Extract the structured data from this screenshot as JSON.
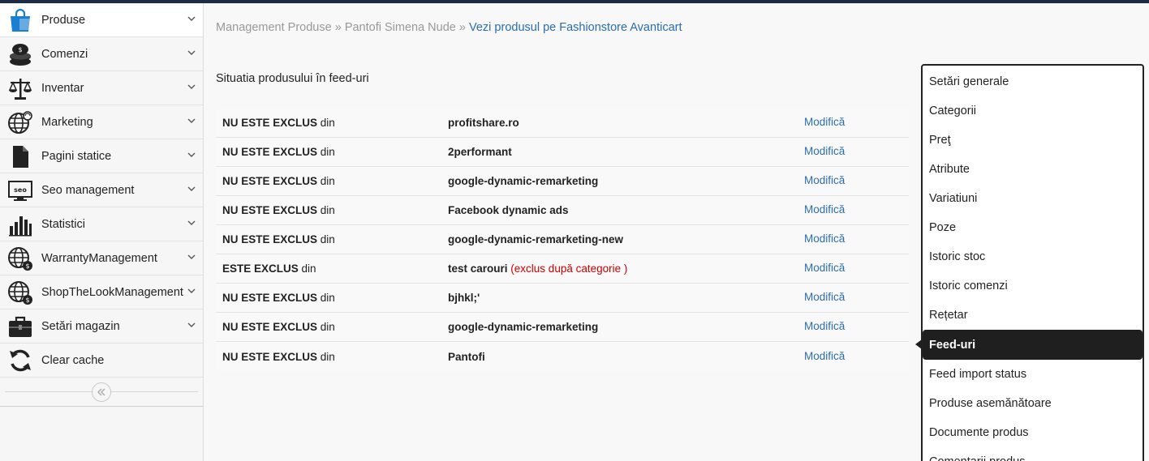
{
  "sidebar": {
    "items": [
      {
        "label": "Produse",
        "icon": "shopping-bag-icon",
        "active": true
      },
      {
        "label": "Comenzi",
        "icon": "coins-icon"
      },
      {
        "label": "Inventar",
        "icon": "scale-icon"
      },
      {
        "label": "Marketing",
        "icon": "globe-signal-icon"
      },
      {
        "label": "Pagini statice",
        "icon": "document-icon"
      },
      {
        "label": "Seo management",
        "icon": "seo-monitor-icon"
      },
      {
        "label": "Statistici",
        "icon": "bar-chart-icon"
      },
      {
        "label": "WarrantyManagement",
        "icon": "globe-dollar-icon"
      },
      {
        "label": "ShopTheLookManagement",
        "icon": "globe-dollar-icon"
      },
      {
        "label": "Setări magazin",
        "icon": "briefcase-icon"
      },
      {
        "label": "Clear cache",
        "icon": "refresh-icon"
      }
    ],
    "collapse_icon": "double-chevron-left-icon"
  },
  "breadcrumb": {
    "part1": "Management Produse",
    "sep": "»",
    "part2": "Pantofi Simena Nude",
    "link": "Vezi produsul pe Fashionstore Avanticart"
  },
  "section_title": "Situatia produsului în feed-uri",
  "feeds": [
    {
      "status": "NU ESTE EXCLUS",
      "din": "din",
      "feed": "profitshare.ro",
      "reason": "",
      "action": "Modifică"
    },
    {
      "status": "NU ESTE EXCLUS",
      "din": "din",
      "feed": "2performant",
      "reason": "",
      "action": "Modifică"
    },
    {
      "status": "NU ESTE EXCLUS",
      "din": "din",
      "feed": "google-dynamic-remarketing",
      "reason": "",
      "action": "Modifică"
    },
    {
      "status": "NU ESTE EXCLUS",
      "din": "din",
      "feed": "Facebook dynamic ads",
      "reason": "",
      "action": "Modifică"
    },
    {
      "status": "NU ESTE EXCLUS",
      "din": "din",
      "feed": "google-dynamic-remarketing-new",
      "reason": "",
      "action": "Modifică"
    },
    {
      "status": "ESTE EXCLUS",
      "din": "din",
      "feed": "test carouri",
      "reason": "(exclus după categorie )",
      "action": "Modifică"
    },
    {
      "status": "NU ESTE EXCLUS",
      "din": "din",
      "feed": "bjhkl;'",
      "reason": "",
      "action": "Modifică"
    },
    {
      "status": "NU ESTE EXCLUS",
      "din": "din",
      "feed": "google-dynamic-remarketing",
      "reason": "",
      "action": "Modifică"
    },
    {
      "status": "NU ESTE EXCLUS",
      "din": "din",
      "feed": "Pantofi",
      "reason": "",
      "action": "Modifică"
    }
  ],
  "side_menu": [
    {
      "label": "Setări generale"
    },
    {
      "label": "Categorii"
    },
    {
      "label": "Preţ"
    },
    {
      "label": "Atribute"
    },
    {
      "label": "Variatiuni"
    },
    {
      "label": "Poze"
    },
    {
      "label": "Istoric stoc"
    },
    {
      "label": "Istoric comenzi"
    },
    {
      "label": "Rețetar"
    },
    {
      "label": "Feed-uri",
      "active": true
    },
    {
      "label": "Feed import status"
    },
    {
      "label": "Produse asemănătoare"
    },
    {
      "label": "Documente produs"
    },
    {
      "label": "Comentarii produs"
    }
  ],
  "colors": {
    "link": "#2a6db0",
    "excluded_reason": "#cc0000",
    "active_menu_bg": "#1f1f1f",
    "topbar": "#1f2a44",
    "icon_blue": "#1a7fd0"
  }
}
